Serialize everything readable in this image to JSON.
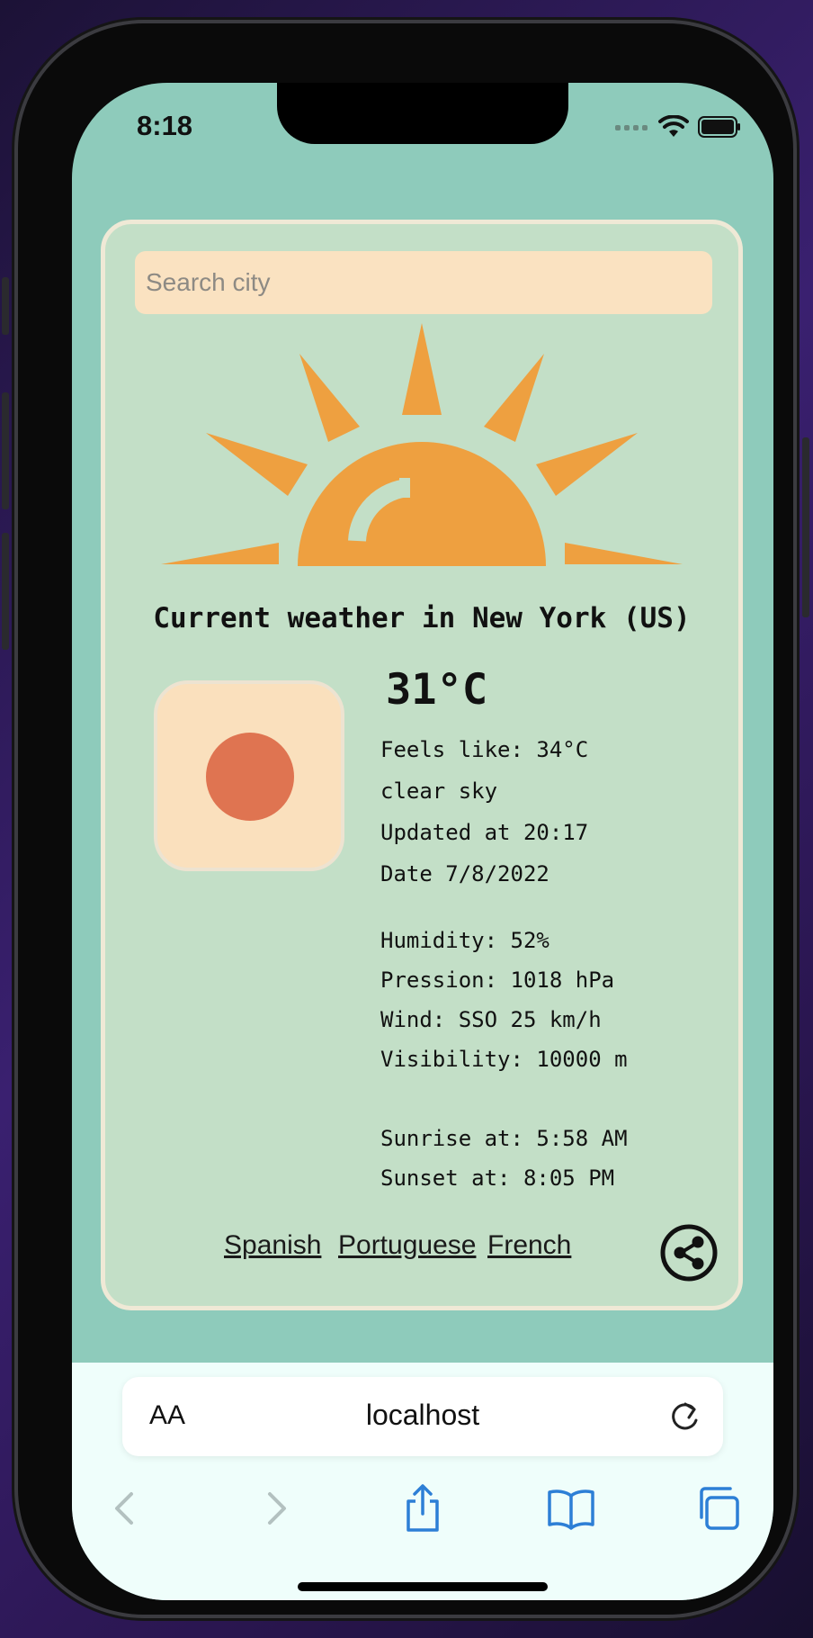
{
  "status_bar": {
    "time": "8:18"
  },
  "search": {
    "placeholder": "Search city",
    "value": ""
  },
  "weather": {
    "heading": "Current weather in New York (US)",
    "temperature": "31°C",
    "feels_like": "Feels like: 34°C",
    "description": "clear sky",
    "updated": "Updated at 20:17",
    "date": "Date 7/8/2022",
    "humidity": "Humidity: 52%",
    "pression": "Pression: 1018 hPa",
    "wind": "Wind: SSO 25 km/h",
    "visibility": "Visibility: 10000 m",
    "sunrise": "Sunrise at: 5:58 AM",
    "sunset": "Sunset at: 8:05 PM"
  },
  "languages": [
    "Spanish",
    "Portuguese",
    "French"
  ],
  "colors": {
    "screen_bg": "#8ecbbb",
    "card_bg": "#c3dfc7",
    "sun": "#eea040",
    "weather_icon": "#df7451",
    "search_bg": "#fae2c1"
  },
  "browser": {
    "text_size_label": "AA",
    "url": "localhost"
  },
  "icons": {
    "share": "share-icon",
    "reload": "reload-icon",
    "back": "chevron-left-icon",
    "forward": "chevron-right-icon",
    "share_sheet": "share-sheet-icon",
    "bookmarks": "book-icon",
    "tabs": "tabs-icon"
  }
}
